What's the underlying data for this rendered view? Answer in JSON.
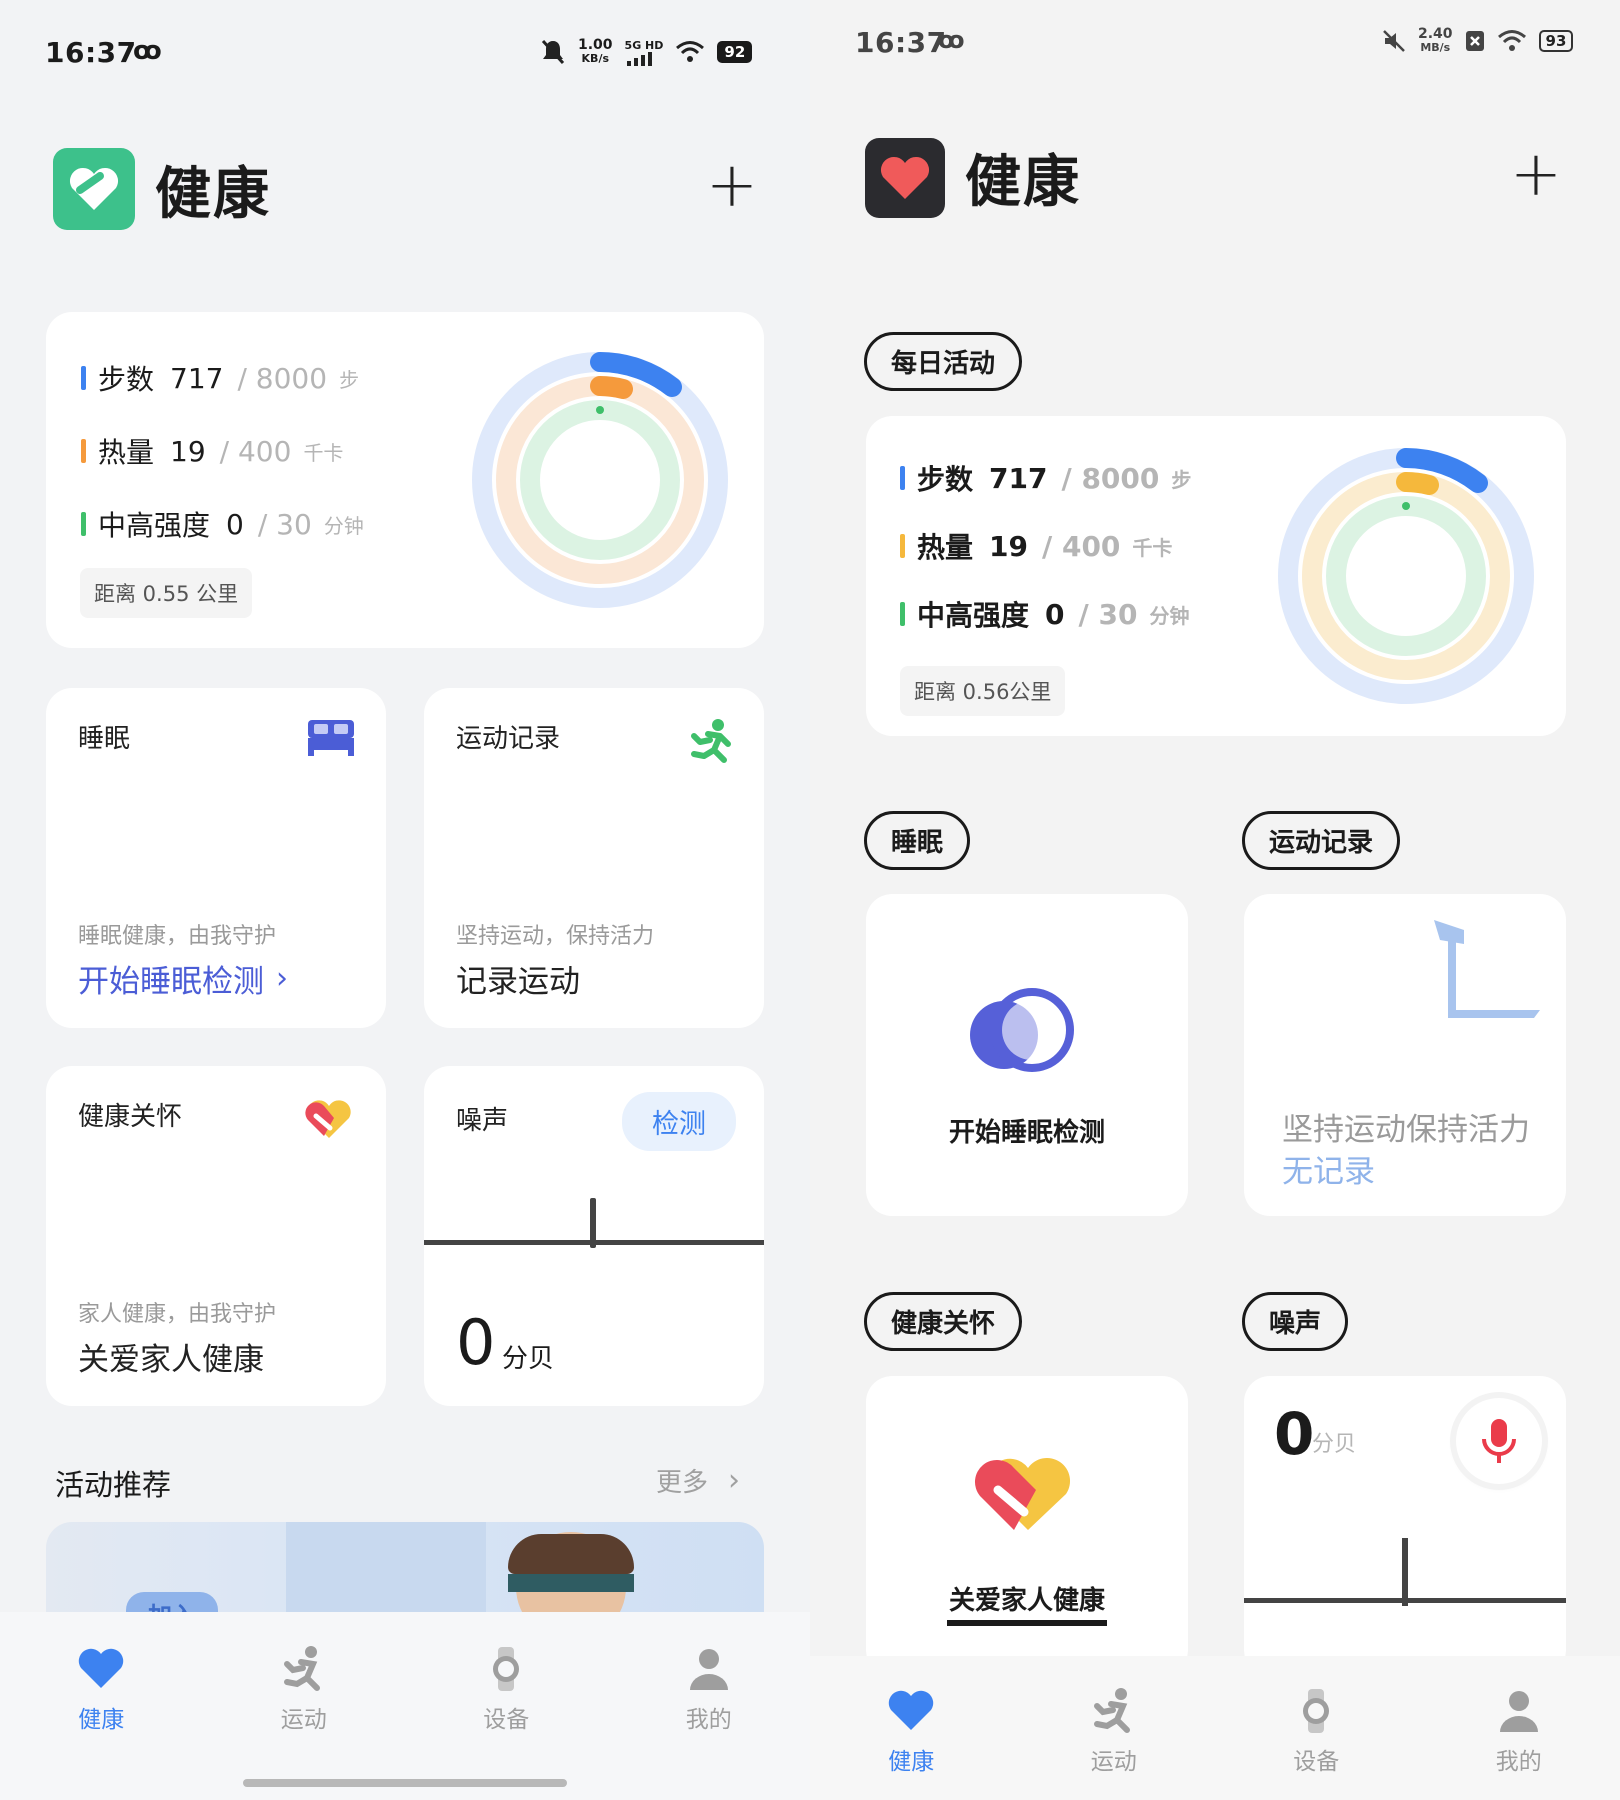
{
  "left": {
    "status": {
      "time": "16:37",
      "speed_value": "1.00",
      "speed_unit": "KB/s",
      "network": "5G HD",
      "battery": "92"
    },
    "header": {
      "title": "健康"
    },
    "activity": {
      "steps": {
        "label": "步数",
        "value": "717",
        "goal": "/ 8000",
        "unit": "步"
      },
      "calories": {
        "label": "热量",
        "value": "19",
        "goal": "/ 400",
        "unit": "千卡"
      },
      "intensity": {
        "label": "中高强度",
        "value": "0",
        "goal": "/ 30",
        "unit": "分钟"
      },
      "distance": "距离 0.55 公里"
    },
    "sleep": {
      "title": "睡眠",
      "sub": "睡眠健康，由我守护",
      "action": "开始睡眠检测"
    },
    "workout": {
      "title": "运动记录",
      "sub": "坚持运动，保持活力",
      "action": "记录运动"
    },
    "care": {
      "title": "健康关怀",
      "sub": "家人健康，由我守护",
      "action": "关爱家人健康"
    },
    "noise": {
      "title": "噪声",
      "button": "检测",
      "value": "0",
      "unit": "分贝"
    },
    "recommend": {
      "title": "活动推荐",
      "more": "更多",
      "banner_text": "加入"
    },
    "tabs": [
      "健康",
      "运动",
      "设备",
      "我的"
    ]
  },
  "right": {
    "status": {
      "time": "16:37",
      "speed_value": "2.40",
      "speed_unit": "MB/s",
      "battery": "93"
    },
    "header": {
      "title": "健康"
    },
    "daily_label": "每日活动",
    "activity": {
      "steps": {
        "label": "步数",
        "value": "717",
        "goal": "/ 8000",
        "unit": "步"
      },
      "calories": {
        "label": "热量",
        "value": "19",
        "goal": "/ 400",
        "unit": "千卡"
      },
      "intensity": {
        "label": "中高强度",
        "value": "0",
        "goal": "/ 30",
        "unit": "分钟"
      },
      "distance": "距离 0.56公里"
    },
    "sleep_label": "睡眠",
    "workout_label": "运动记录",
    "sleep_action": "开始睡眠检测",
    "workout_sub": "坚持运动保持活力",
    "workout_status": "无记录",
    "care_label": "健康关怀",
    "noise_label": "噪声",
    "care_action": "关爱家人健康",
    "noise_value": "0",
    "noise_unit": "分贝",
    "tabs": [
      "健康",
      "运动",
      "设备",
      "我的"
    ]
  },
  "colors": {
    "steps": "#3d82f0",
    "calories": "#f59a3c",
    "intensity": "#3fbf6a",
    "accent": "#3d82f0",
    "sleep_accent": "#5660d8"
  }
}
